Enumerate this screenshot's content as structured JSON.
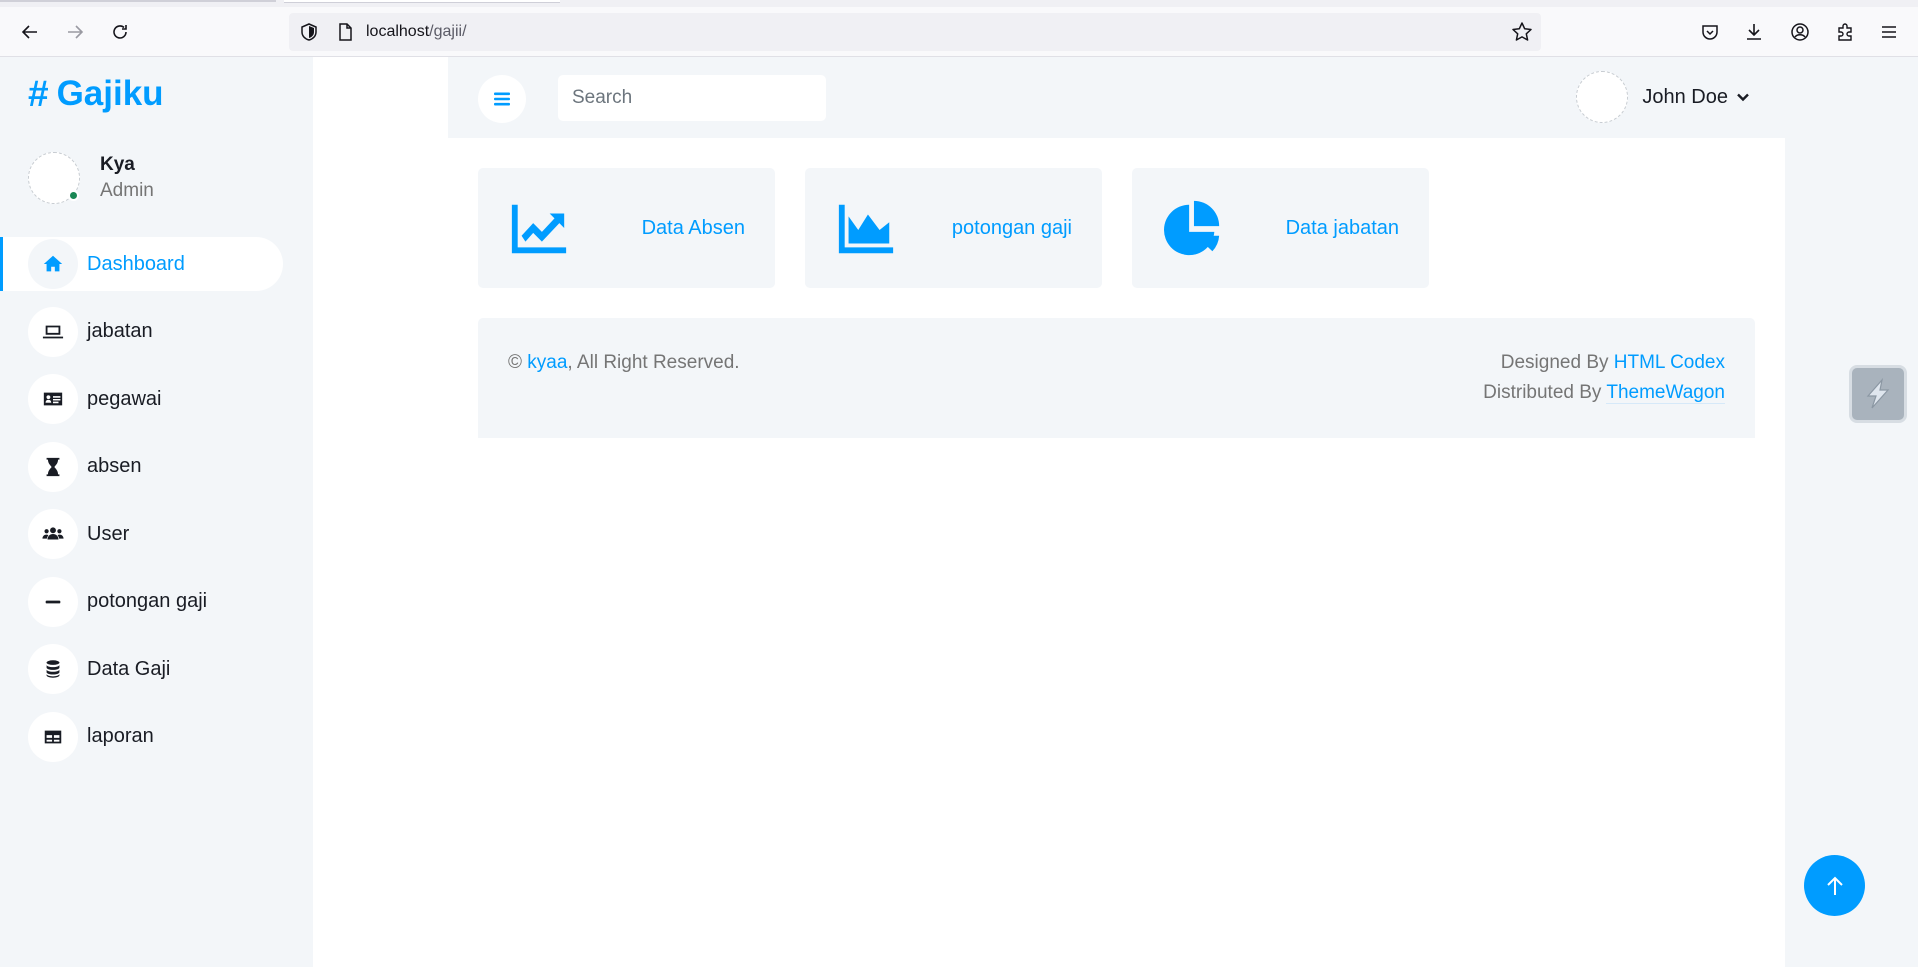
{
  "browser": {
    "url_host": "localhost",
    "url_path": "/gajii/"
  },
  "sidebar": {
    "brand": "Gajiku",
    "brand_icon": "hashtag-icon",
    "user": {
      "name": "Kya",
      "role": "Admin"
    },
    "items": [
      {
        "label": "Dashboard",
        "icon": "home-icon",
        "active": true
      },
      {
        "label": "jabatan",
        "icon": "laptop-icon"
      },
      {
        "label": "pegawai",
        "icon": "id-card-icon"
      },
      {
        "label": "absen",
        "icon": "hourglass-icon"
      },
      {
        "label": "User",
        "icon": "users-icon"
      },
      {
        "label": "potongan gaji",
        "icon": "minus-icon"
      },
      {
        "label": "Data Gaji",
        "icon": "database-icon"
      },
      {
        "label": "laporan",
        "icon": "table-icon"
      }
    ]
  },
  "topnav": {
    "search_placeholder": "Search",
    "profile_name": "John Doe"
  },
  "cards": [
    {
      "label": "Data Absen",
      "icon": "chart-line-icon"
    },
    {
      "label": "potongan gaji",
      "icon": "chart-area-icon"
    },
    {
      "label": "Data jabatan",
      "icon": "chart-pie-icon"
    }
  ],
  "footer": {
    "copyright_symbol": "©",
    "owner": "kyaa",
    "rights": ", All Right Reserved.",
    "designed_prefix": "Designed By ",
    "designed_link": "HTML Codex",
    "distributed_prefix": "Distributed By ",
    "distributed_link": "ThemeWagon"
  },
  "colors": {
    "primary": "#009cff",
    "sidebar_bg": "#f3f6f9",
    "dark": "#191c24",
    "online": "#198754"
  }
}
